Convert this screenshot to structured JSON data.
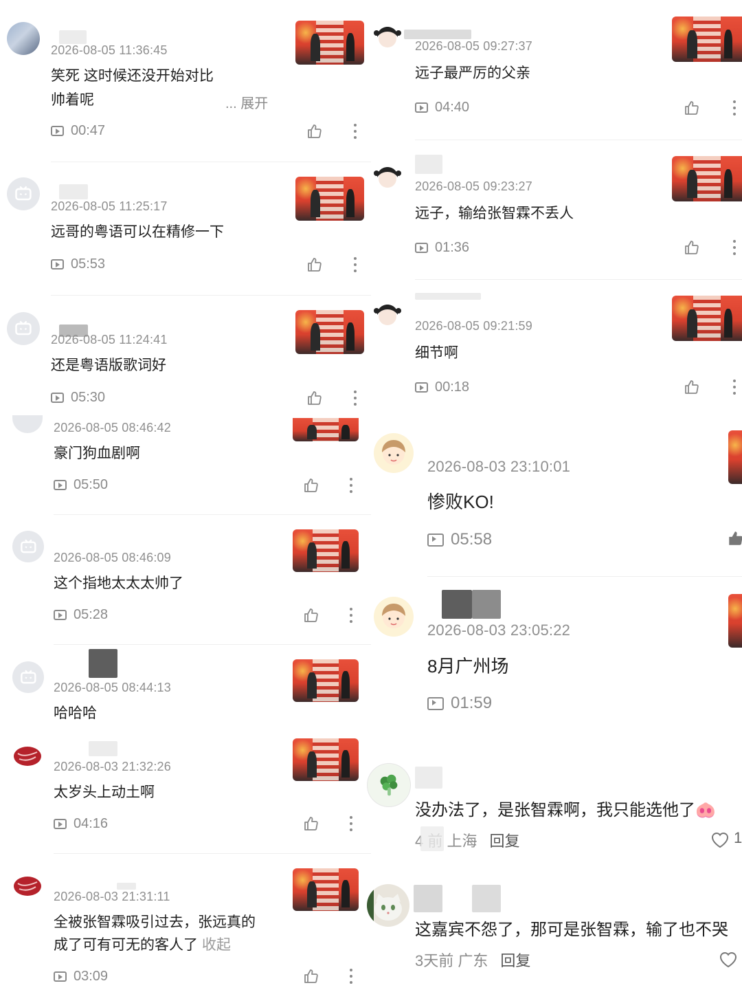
{
  "left": [
    {
      "time": "2026-08-05 11:36:45",
      "lines": [
        "笑死 这时候还没开始对比",
        "帅着呢"
      ],
      "expand": "... 展开",
      "duration": "00:47",
      "avatar": "photo-avatar"
    },
    {
      "time": "2026-08-05 11:25:17",
      "lines": [
        "远哥的粤语可以在精修一下"
      ],
      "duration": "05:53",
      "avatar": "tv-avatar"
    },
    {
      "time": "2026-08-05 11:24:41",
      "lines": [
        "还是粤语版歌词好"
      ],
      "duration": "05:30",
      "avatar": "tv-avatar"
    },
    {
      "time": "2026-08-05 08:46:42",
      "lines": [
        "豪门狗血剧啊"
      ],
      "duration": "05:50",
      "avatar": "tv-avatar"
    },
    {
      "time": "2026-08-05 08:46:09",
      "lines": [
        "这个指地太太太帅了"
      ],
      "duration": "05:28",
      "avatar": "tv-avatar"
    },
    {
      "time": "2026-08-05 08:44:13",
      "lines": [
        "哈哈哈"
      ],
      "duration": "",
      "avatar": "tv-avatar"
    },
    {
      "time": "2026-08-03 21:32:26",
      "lines": [
        "太岁头上动土啊"
      ],
      "duration": "04:16",
      "avatar": "meat-avatar"
    },
    {
      "time": "2026-08-03 21:31:11",
      "lines": [
        "全被张智霖吸引过去，张远真的",
        "成了可有可无的客人了"
      ],
      "collapse": "收起",
      "duration": "03:09",
      "avatar": "meat-avatar"
    }
  ],
  "right": [
    {
      "time": "2026-08-05 09:27:37",
      "text": "远子最严厉的父亲",
      "duration": "04:40"
    },
    {
      "time": "2026-08-05 09:23:27",
      "text": "远子，输给张智霖不丢人",
      "duration": "01:36"
    },
    {
      "time": "2026-08-05 09:21:59",
      "text": "细节啊",
      "duration": "00:18"
    },
    {
      "time": "2026-08-03 23:10:01",
      "text": "惨败KO!",
      "duration": "05:58"
    },
    {
      "time": "2026-08-03 23:05:22",
      "text": "8月广州场",
      "duration": "01:59"
    }
  ],
  "replies": [
    {
      "text": "没办法了，是张智霖啊，我只能选他了🐽",
      "meta": "4  前 上海",
      "reply": "回复",
      "likes": "1"
    },
    {
      "text": "这嘉宾不怨了，那可是张智霖，输了也不哭",
      "meta": "3天前 广东",
      "reply": "回复",
      "likes": ""
    }
  ]
}
